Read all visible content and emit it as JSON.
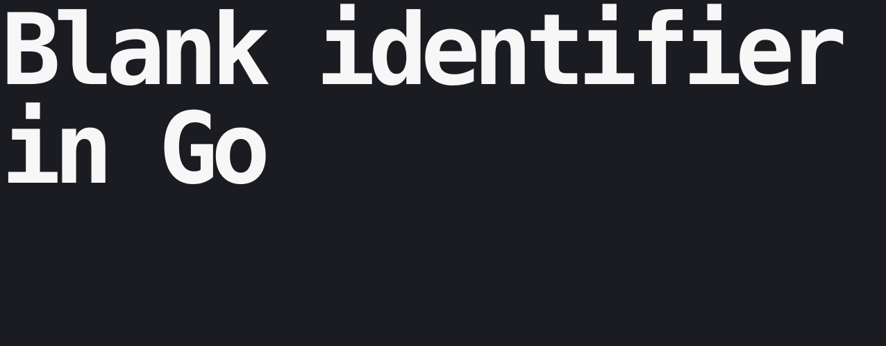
{
  "title": {
    "line1": "Blank identifier",
    "line2": "in Go"
  },
  "colors": {
    "background": "#1b1c21",
    "text": "#f7f7f7"
  }
}
